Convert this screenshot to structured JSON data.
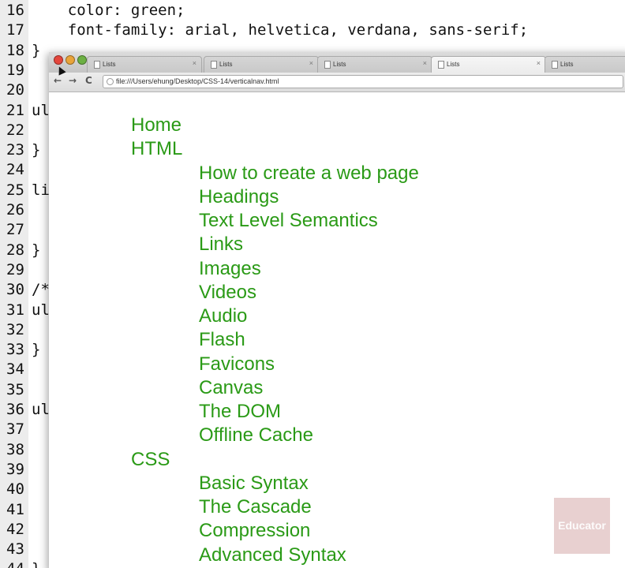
{
  "editor": {
    "lines": [
      {
        "num": "16",
        "code": "    color: green;"
      },
      {
        "num": "17",
        "code": "    font-family: arial, helvetica, verdana, sans-serif;"
      },
      {
        "num": "18",
        "code": "}"
      },
      {
        "num": "19",
        "code": ""
      },
      {
        "num": "20",
        "code": ""
      },
      {
        "num": "21",
        "code": "ul"
      },
      {
        "num": "22",
        "code": ""
      },
      {
        "num": "23",
        "code": "}"
      },
      {
        "num": "24",
        "code": ""
      },
      {
        "num": "25",
        "code": "li"
      },
      {
        "num": "26",
        "code": ""
      },
      {
        "num": "27",
        "code": ""
      },
      {
        "num": "28",
        "code": "}"
      },
      {
        "num": "29",
        "code": ""
      },
      {
        "num": "30",
        "code": "/*"
      },
      {
        "num": "31",
        "code": "ul"
      },
      {
        "num": "32",
        "code": ""
      },
      {
        "num": "33",
        "code": "}"
      },
      {
        "num": "34",
        "code": ""
      },
      {
        "num": "35",
        "code": ""
      },
      {
        "num": "36",
        "code": "ul"
      },
      {
        "num": "37",
        "code": ""
      },
      {
        "num": "38",
        "code": ""
      },
      {
        "num": "39",
        "code": ""
      },
      {
        "num": "40",
        "code": ""
      },
      {
        "num": "41",
        "code": ""
      },
      {
        "num": "42",
        "code": ""
      },
      {
        "num": "43",
        "code": ""
      },
      {
        "num": "44",
        "code": "}"
      }
    ]
  },
  "browser": {
    "tabs": [
      {
        "label": "Lists",
        "active": false
      },
      {
        "label": "Lists",
        "active": false
      },
      {
        "label": "Lists",
        "active": false
      },
      {
        "label": "Lists",
        "active": true
      },
      {
        "label": "Lists",
        "active": false
      }
    ],
    "tab_close_glyph": "×",
    "toolbar": {
      "back_glyph": "←",
      "forward_glyph": "→",
      "reload_glyph": "C",
      "url": "file:///Users/ehung/Desktop/CSS-14/verticalnav.html"
    },
    "page": {
      "text_color": "#2a9a16",
      "nav": [
        {
          "label": "Home",
          "level": 0
        },
        {
          "label": "HTML",
          "level": 0
        },
        {
          "label": "How to create a web page",
          "level": 1
        },
        {
          "label": "Headings",
          "level": 1
        },
        {
          "label": "Text Level Semantics",
          "level": 1
        },
        {
          "label": "Links",
          "level": 1
        },
        {
          "label": "Images",
          "level": 1
        },
        {
          "label": "Videos",
          "level": 1
        },
        {
          "label": "Audio",
          "level": 1
        },
        {
          "label": "Flash",
          "level": 1
        },
        {
          "label": "Favicons",
          "level": 1
        },
        {
          "label": "Canvas",
          "level": 1
        },
        {
          "label": "The DOM",
          "level": 1
        },
        {
          "label": "Offline Cache",
          "level": 1
        },
        {
          "label": "CSS",
          "level": 0
        },
        {
          "label": "Basic Syntax",
          "level": 1
        },
        {
          "label": "The Cascade",
          "level": 1
        },
        {
          "label": "Compression",
          "level": 1
        },
        {
          "label": "Advanced Syntax",
          "level": 1
        }
      ]
    }
  },
  "watermark": {
    "text": "Educator"
  },
  "icons": {
    "close": "close-icon",
    "minimize": "minimize-icon",
    "maximize": "maximize-icon",
    "back": "back-arrow-icon",
    "forward": "forward-arrow-icon",
    "reload": "reload-icon",
    "page": "page-info-icon",
    "tab_document": "document-icon",
    "cursor": "mouse-cursor-icon"
  }
}
